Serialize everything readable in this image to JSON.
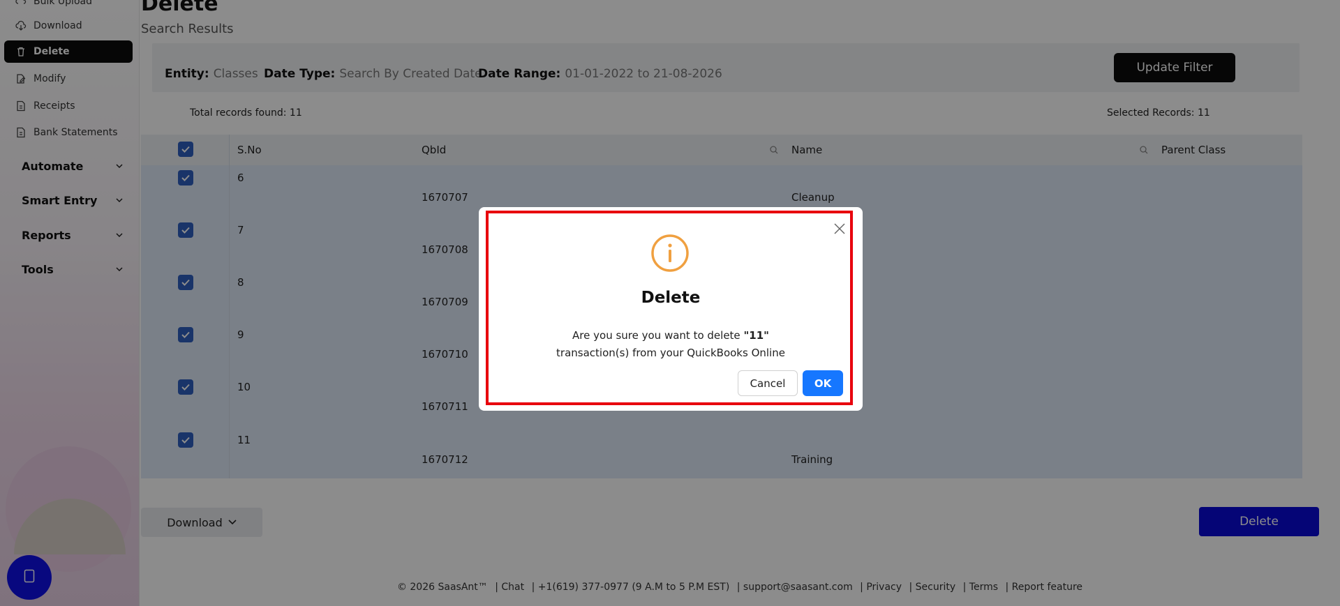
{
  "sidebar": {
    "items": [
      {
        "label": "Bulk Upload"
      },
      {
        "label": "Download"
      },
      {
        "label": "Delete"
      },
      {
        "label": "Modify"
      },
      {
        "label": "Receipts"
      },
      {
        "label": "Bank Statements"
      }
    ],
    "groups": [
      {
        "label": "Automate"
      },
      {
        "label": "Smart Entry"
      },
      {
        "label": "Reports"
      },
      {
        "label": "Tools"
      }
    ],
    "help_icon": "help-icon"
  },
  "header": {
    "title": "Delete",
    "subtitle": "Search Results"
  },
  "filter": {
    "entity_label": "Entity:",
    "entity_value": "Classes",
    "date_type_label": "Date Type:",
    "date_type_value": "Search By Created Date",
    "date_range_label": "Date Range:",
    "date_range_value": "01-01-2022 to 21-08-2026",
    "update_button": "Update Filter"
  },
  "summary": {
    "total": "Total records found: 11",
    "selected": "Selected Records: 11"
  },
  "table": {
    "columns": [
      "S.No",
      "QbId",
      "Name",
      "Parent Class"
    ],
    "rows": [
      {
        "sno": "6",
        "qbid": "1670707",
        "name": "Cleanup"
      },
      {
        "sno": "7",
        "qbid": "1670708",
        "name": ""
      },
      {
        "sno": "8",
        "qbid": "1670709",
        "name": ""
      },
      {
        "sno": "9",
        "qbid": "1670710",
        "name": ""
      },
      {
        "sno": "10",
        "qbid": "1670711",
        "name": ""
      },
      {
        "sno": "11",
        "qbid": "1670712",
        "name": "Training"
      }
    ]
  },
  "actions": {
    "download": "Download",
    "delete": "Delete"
  },
  "footer": {
    "copyright": "© 2026 SaasAnt™",
    "chat": "| Chat",
    "phone": "| +1(619) 377-0977 (9 A.M to 5 P.M EST)",
    "email": "| support@saasant.com",
    "privacy": "| Privacy",
    "security": "| Security",
    "terms": "| Terms",
    "report": "| Report feature"
  },
  "modal": {
    "title": "Delete",
    "message_prefix": "Are you sure you want to delete ",
    "message_count": "\"11\"",
    "message_suffix": "transaction(s) from your QuickBooks Online",
    "cancel": "Cancel",
    "ok": "OK",
    "icon": "info-icon",
    "accent": "#f0a040",
    "highlight_color": "#e8000d"
  }
}
